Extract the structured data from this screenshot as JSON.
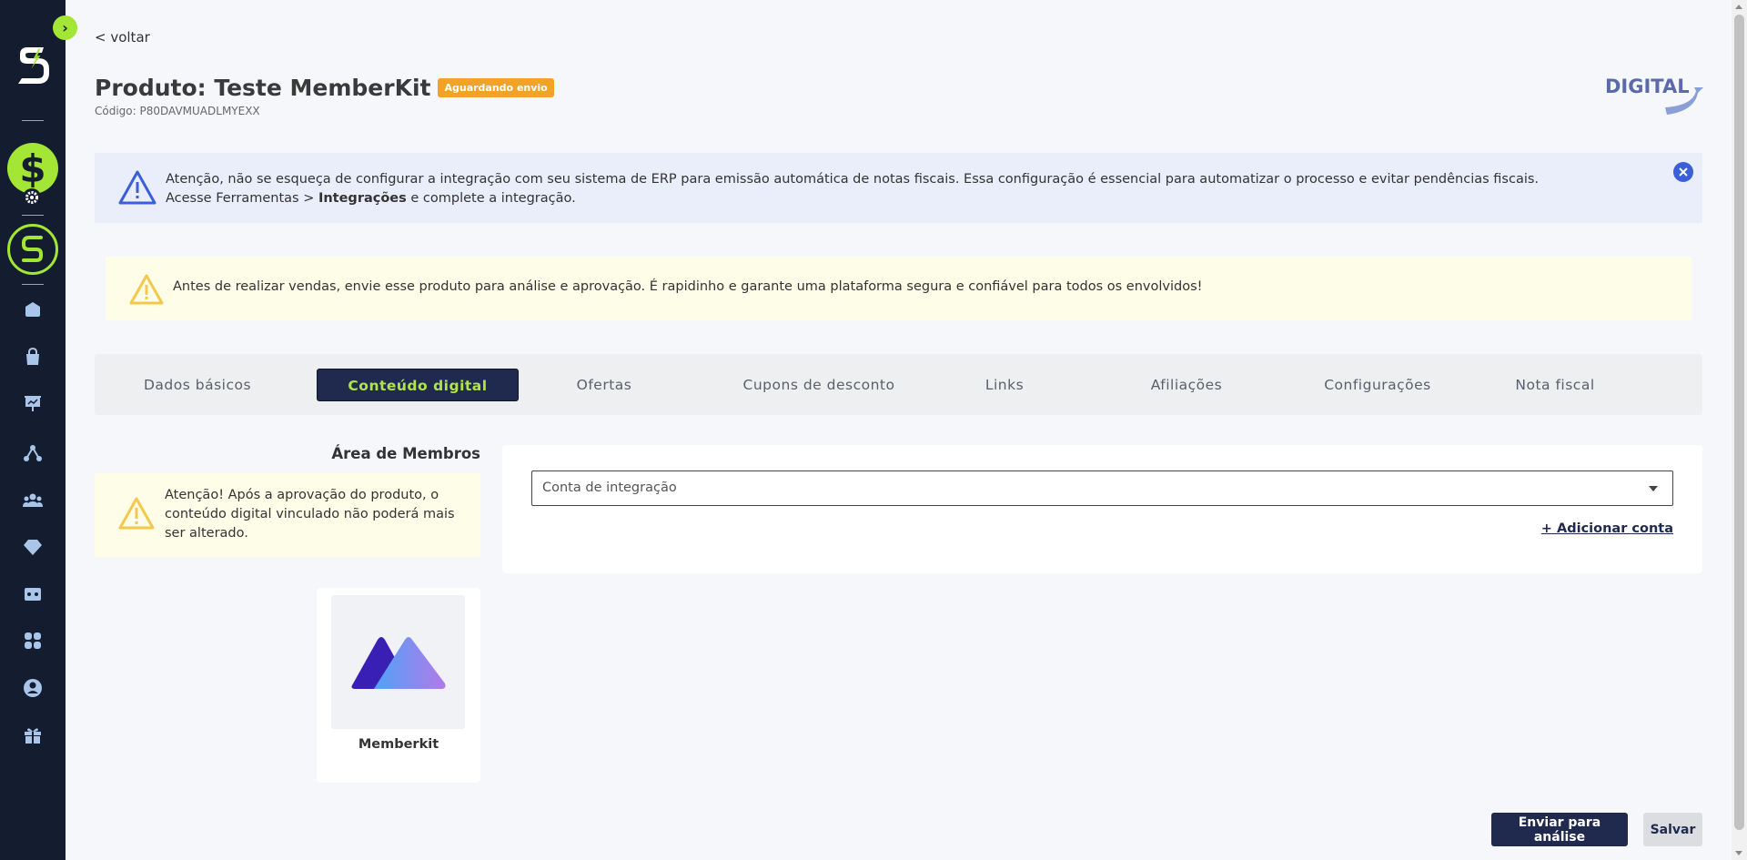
{
  "nav": {
    "back_label": "< voltar"
  },
  "product": {
    "title": "Produto: Teste MemberKit",
    "status": "Aguardando envio",
    "code": "Código: P80DAVMUADLMYEXX",
    "brand_logo_text": "DIGITAL"
  },
  "alerts": {
    "erp": {
      "line1": "Atenção, não se esqueça de configurar a integração com seu sistema de ERP para emissão automática de notas fiscais. Essa configuração é essencial para automatizar o processo e evitar pendências fiscais.",
      "line2_prefix": "Acesse Ferramentas > ",
      "line2_bold": "Integrações",
      "line2_suffix": " e complete a integração."
    },
    "review": {
      "text": "Antes de realizar vendas, envie esse produto para análise e aprovação. É rapidinho e garante uma plataforma segura e confiável para todos os envolvidos!"
    }
  },
  "tabs": [
    {
      "label": "Dados básicos",
      "active": false
    },
    {
      "label": "Conteúdo digital",
      "active": true
    },
    {
      "label": "Ofertas",
      "active": false
    },
    {
      "label": "Cupons de desconto",
      "active": false
    },
    {
      "label": "Links",
      "active": false
    },
    {
      "label": "Afiliações",
      "active": false
    },
    {
      "label": "Configurações",
      "active": false
    },
    {
      "label": "Nota fiscal",
      "active": false
    }
  ],
  "members": {
    "title": "Área de Membros",
    "warning": "Atenção! Após a aprovação do produto, o conteúdo digital vinculado não poderá mais ser alterado.",
    "integration_name": "Memberkit"
  },
  "integration_panel": {
    "select_placeholder": "Conta de integração",
    "add_account_label": "+ Adicionar conta"
  },
  "actions": {
    "submit_label": "Enviar para análise",
    "save_label": "Salvar"
  },
  "colors": {
    "sidebar_bg": "#141c2f",
    "accent_green": "#a3e635",
    "primary_navy": "#1f2a4e",
    "badge_orange": "#f0a324",
    "info_blue": "#3a5fd9",
    "warning_yellow": "#f2c94c"
  }
}
